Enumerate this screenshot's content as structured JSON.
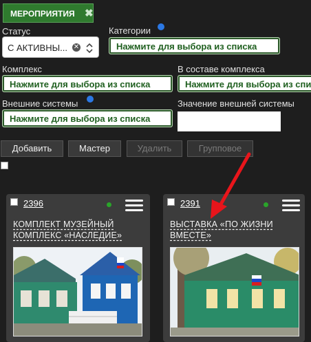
{
  "tab": {
    "label": "МЕРОПРИЯТИЯ",
    "close": "✖"
  },
  "filters": {
    "status": {
      "label": "Статус",
      "value": "С АКТИВНЫ..."
    },
    "category": {
      "label": "Категории",
      "value": "Нажмите для выбора из списка"
    },
    "complex": {
      "label": "Комплекс",
      "value": "Нажмите для выбора из списка"
    },
    "in_complex": {
      "label": "В составе комплекса",
      "value": "Нажмите для выбора из списка"
    },
    "external": {
      "label": "Внешние системы",
      "value": "Нажмите для выбора из списка"
    },
    "external_value": {
      "label": "Значение внешней системы",
      "value": ""
    }
  },
  "toolbar": {
    "add": "Добавить",
    "master": "Мастер",
    "delete": "Удалить",
    "group": "Групповое"
  },
  "cards": [
    {
      "id": "2396",
      "title_line1": "КОМПЛЕКТ МУЗЕЙНЫЙ",
      "title_line2": "КОМПЛЕКС «НАСЛЕДИЕ»"
    },
    {
      "id": "2391",
      "title_line1": "ВЫСТАВКА «ПО ЖИЗНИ",
      "title_line2": "ВМЕСТЕ»"
    }
  ],
  "colors": {
    "accent": "#2f7a2e",
    "field_text": "#1f5f1f",
    "annotation_arrow": "#e8151b"
  }
}
